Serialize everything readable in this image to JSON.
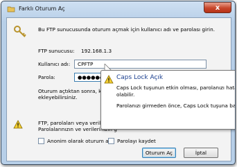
{
  "window": {
    "title": "Farklı Oturum Aç",
    "close_label": "x"
  },
  "dialog": {
    "intro": "Bu FTP sunucusunda oturum açmak için kullanıcı adı ve parolası girin.",
    "server_label": "FTP sunucusu:",
    "server_value": "192.168.1.3",
    "username_label": "Kullanıcı adı:",
    "username_value": "CPFTP",
    "password_label": "Parola:",
    "password_value": "●●●●●●●●●",
    "after_login_line1": "Oturum açtıktan sonra, kolayc",
    "after_login_line2": "ekleyebilirsiniz.",
    "warning_line1": "FTP, parolaları veya verileri s",
    "warning_line2": "Parolalarınızın ve verilerinizin g",
    "anonymous_label": "Anonim olarak oturum aç",
    "save_password_label": "Parolayı kaydet",
    "login_button": "Oturum Aç",
    "cancel_button": "İptal"
  },
  "tooltip": {
    "title": "Caps Lock Açık",
    "line1": "Caps Lock tuşunun etkin olması, parolanızı hata",
    "line2": "olabilir.",
    "line3": "Parolanızı girmeden önce, Caps Lock tuşuna bas"
  }
}
